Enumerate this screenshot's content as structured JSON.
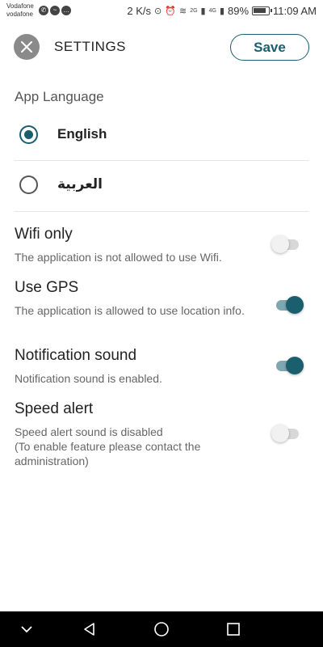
{
  "status_bar": {
    "carrier_1": "Vodafone",
    "carrier_2": "vodafone",
    "speed": "2 K/s",
    "battery": "89%",
    "time": "11:09 AM",
    "net_1": "2G",
    "net_2": "4G"
  },
  "header": {
    "title": "SETTINGS",
    "save_label": "Save"
  },
  "language": {
    "section_title": "App Language",
    "options": [
      {
        "label": "English",
        "selected": true
      },
      {
        "label": "العربية",
        "selected": false
      }
    ]
  },
  "settings": [
    {
      "title": "Wifi only",
      "description": "The application is not allowed to use Wifi.",
      "enabled": false
    },
    {
      "title": "Use GPS",
      "description": "The application is allowed to use location info.",
      "enabled": true
    },
    {
      "title": "Notification sound",
      "description": "Notification sound is enabled.",
      "enabled": true
    },
    {
      "title": "Speed alert",
      "description": "Speed alert sound is disabled\n(To enable feature please contact the administration)",
      "enabled": false
    }
  ],
  "colors": {
    "accent": "#1b5e6e",
    "accent_track": "#7fa7b1"
  },
  "icons": {
    "close": "close-icon",
    "back": "back-triangle-icon",
    "home": "home-circle-icon",
    "recents": "recents-square-icon",
    "collapse": "chevron-down-icon"
  }
}
